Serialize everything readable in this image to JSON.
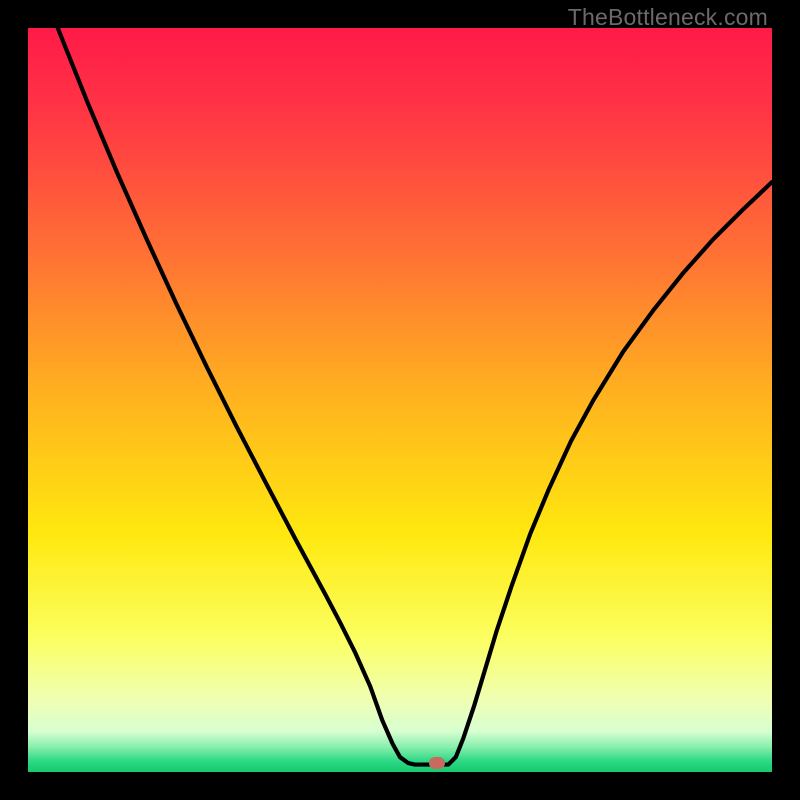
{
  "watermark": "TheBottleneck.com",
  "chart_data": {
    "type": "line",
    "title": "",
    "xlabel": "",
    "ylabel": "",
    "xlim": [
      0,
      100
    ],
    "ylim": [
      0,
      100
    ],
    "gradient_stops": [
      {
        "offset": 0.0,
        "color": "#ff1a49"
      },
      {
        "offset": 0.12,
        "color": "#ff3744"
      },
      {
        "offset": 0.3,
        "color": "#ff7035"
      },
      {
        "offset": 0.5,
        "color": "#ffb41e"
      },
      {
        "offset": 0.68,
        "color": "#ffe80f"
      },
      {
        "offset": 0.82,
        "color": "#fbff60"
      },
      {
        "offset": 0.9,
        "color": "#f0ffb0"
      },
      {
        "offset": 0.945,
        "color": "#d8ffd0"
      },
      {
        "offset": 0.965,
        "color": "#8ef0b0"
      },
      {
        "offset": 0.985,
        "color": "#2ed985"
      },
      {
        "offset": 1.0,
        "color": "#15c96f"
      }
    ],
    "series": [
      {
        "name": "left-curve",
        "x": [
          4.0,
          8.0,
          12.0,
          16.0,
          20.0,
          24.0,
          28.0,
          32.0,
          36.0,
          40.0,
          42.0,
          44.0,
          46.0,
          47.6,
          49.0,
          50.0,
          51.1,
          52.0
        ],
        "y": [
          100.0,
          90.0,
          80.5,
          71.5,
          62.8,
          54.5,
          46.5,
          38.8,
          31.2,
          23.8,
          20.0,
          16.0,
          11.5,
          7.0,
          3.8,
          2.0,
          1.2,
          1.0
        ]
      },
      {
        "name": "floor",
        "x": [
          52.0,
          56.5
        ],
        "y": [
          1.0,
          1.0
        ]
      },
      {
        "name": "right-curve",
        "x": [
          56.5,
          57.5,
          58.5,
          60.0,
          61.5,
          63.0,
          65.0,
          67.5,
          70.0,
          73.0,
          76.0,
          80.0,
          84.0,
          88.0,
          92.0,
          96.0,
          100.0
        ],
        "y": [
          1.0,
          2.0,
          4.5,
          9.0,
          14.0,
          19.0,
          25.0,
          32.0,
          38.0,
          44.5,
          50.0,
          56.5,
          62.0,
          67.0,
          71.5,
          75.5,
          79.3
        ]
      }
    ],
    "marker": {
      "x": 55.0,
      "y": 1.2
    }
  }
}
